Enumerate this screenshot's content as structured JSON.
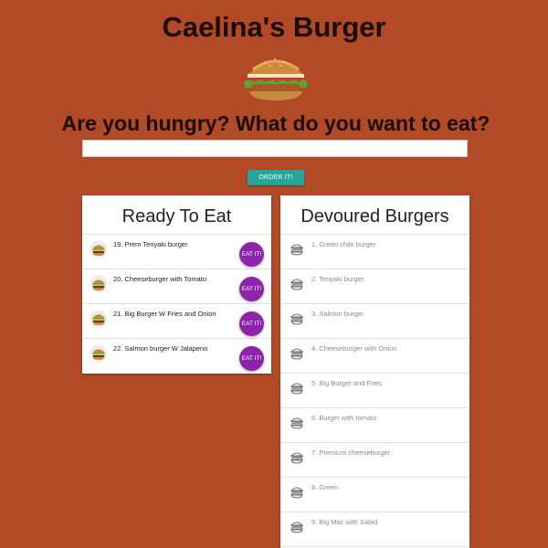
{
  "header": {
    "title": "Caelina's Burger",
    "tagline": "Are you hungry? What do you want to eat?"
  },
  "order_form": {
    "input_value": "",
    "button_label": "ORDER IT!"
  },
  "ready_panel": {
    "title": "Ready To Eat",
    "items": [
      {
        "label": "19. Prem Teriyaki burger",
        "button": "EAT IT!"
      },
      {
        "label": "20. Cheeseburger with Tomato",
        "button": "EAT IT!"
      },
      {
        "label": "21. Big Burger W Fries and Onion",
        "button": "EAT IT!"
      },
      {
        "label": "22. Salmon burger W Jalapeno",
        "button": "EAT IT!"
      }
    ]
  },
  "devoured_panel": {
    "title": "Devoured Burgers",
    "items": [
      {
        "label": "1. Green chile burger"
      },
      {
        "label": "2. Teriyaki burger"
      },
      {
        "label": "3. Salmon burger"
      },
      {
        "label": "4. Cheeseburger with Onion"
      },
      {
        "label": "5. Big Burger and Fries"
      },
      {
        "label": "6. Burger with tomato"
      },
      {
        "label": "7. Premium cheeseburger"
      },
      {
        "label": "8. Green"
      },
      {
        "label": "9. Big Mac with Salad"
      }
    ]
  },
  "colors": {
    "background": "#b34a27",
    "order_button": "#26a69a",
    "eat_button": "#8e24aa"
  },
  "icons": {
    "hero": "burger-image",
    "ready_item": "burger-avatar-icon",
    "devoured_item": "burger-sketch-icon"
  }
}
